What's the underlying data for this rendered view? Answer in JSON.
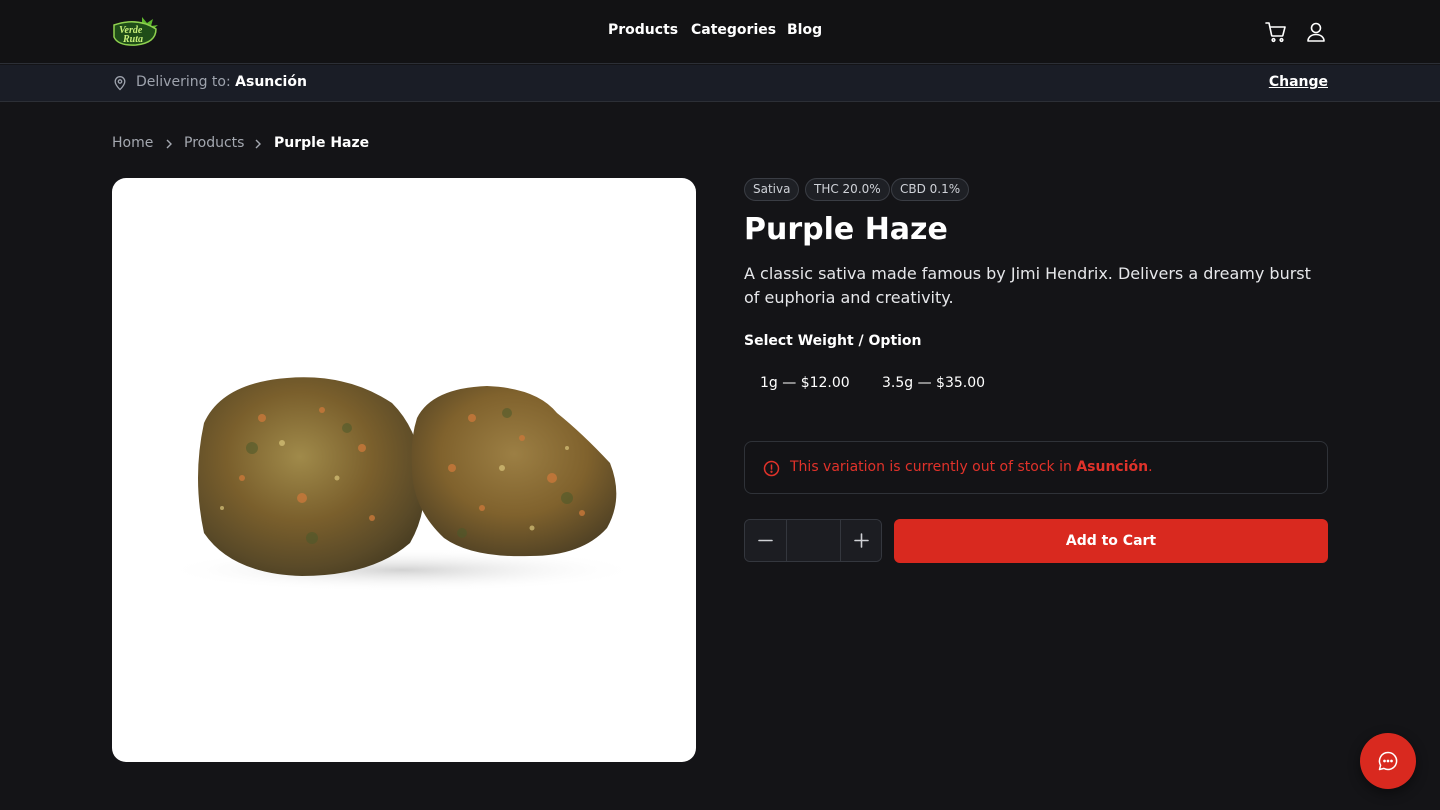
{
  "header": {
    "logo_text": "Verde Ruta",
    "nav": [
      {
        "label": "Products"
      },
      {
        "label": "Categories"
      },
      {
        "label": "Blog"
      }
    ],
    "icons": {
      "cart": "cart-icon",
      "account": "user-icon"
    }
  },
  "delivery": {
    "prefix": "Delivering to:",
    "city": "Asunción",
    "change_label": "Change"
  },
  "breadcrumb": {
    "home": "Home",
    "products": "Products",
    "current": "Purple Haze"
  },
  "product": {
    "badges": [
      "Sativa",
      "THC 20.0%",
      "CBD 0.1%"
    ],
    "name": "Purple Haze",
    "description": "A classic sativa made famous by Jimi Hendrix. Delivers a dreamy burst of euphoria and creativity.",
    "options_label": "Select Weight / Option",
    "options": [
      "1g — $12.00",
      "3.5g — $35.00"
    ],
    "alert": {
      "prefix": "This variation is currently out of stock in",
      "city": "Asunción",
      "suffix": "."
    },
    "quantity_value": "",
    "add_to_cart": "Add to Cart"
  },
  "colors": {
    "accent": "#d9291f",
    "background": "#141417",
    "alert_text": "#e0322a"
  }
}
